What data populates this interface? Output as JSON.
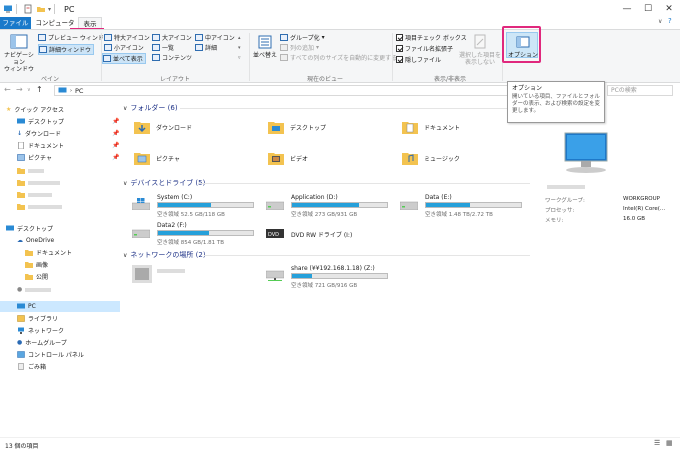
{
  "window": {
    "title": "PC"
  },
  "tabs": {
    "file": "ファイル",
    "computer": "コンピューター",
    "view": "表示"
  },
  "ribbon": {
    "pane_group": {
      "label": "ペイン",
      "nav_pane": "ナビゲーション\nウィンドウ",
      "preview": "プレビュー ウィンドウ",
      "details": "詳細ウィンドウ"
    },
    "layout_group": {
      "label": "レイアウト",
      "items": [
        "特大アイコン",
        "大アイコン",
        "中アイコン",
        "小アイコン",
        "一覧",
        "詳細",
        "並べて表示",
        "コンテンツ"
      ]
    },
    "current_view_group": {
      "label": "現在のビュー",
      "sort": "並べ替え",
      "group_by": "グループ化",
      "add_columns": "列の追加",
      "fit_columns": "すべての列のサイズを自動的に変更する"
    },
    "show_hide_group": {
      "label": "表示/非表示",
      "item_checkbox": "項目チェック ボックス",
      "extensions": "ファイル名拡張子",
      "hidden_files": "隠しファイル",
      "hide_selected": "選択した項目を\n表示しない"
    },
    "options": "オプション"
  },
  "tooltip": {
    "title": "オプション",
    "body": "開いている項目、ファイルとフォルダーの表示、および検索の設定を変更します。"
  },
  "address": {
    "path": "PC",
    "search_placeholder": "PCの検索"
  },
  "nav": {
    "quick_access": "クイック アクセス",
    "desktop": "デスクトップ",
    "downloads": "ダウンロード",
    "documents": "ドキュメント",
    "pictures": "ピクチャ",
    "onedrive_desktop": "デスクトップ",
    "onedrive": "OneDrive",
    "od_documents": "ドキュメント",
    "od_pictures": "画像",
    "od_public": "公開",
    "pc": "PC",
    "libraries": "ライブラリ",
    "network": "ネットワーク",
    "homegroup": "ホームグループ",
    "control_panel": "コントロール パネル",
    "recycle_bin": "ごみ箱"
  },
  "sections": {
    "folders": "フォルダー (6)",
    "devices": "デバイスとドライブ (5)",
    "network": "ネットワークの場所 (2)"
  },
  "folders": [
    "ダウンロード",
    "デスクトップ",
    "ドキュメント",
    "ピクチャ",
    "ビデオ",
    "ミュージック"
  ],
  "drives": [
    {
      "name": "System (C:)",
      "free": "空き領域 52.5 GB/118 GB",
      "used_fraction": 0.56
    },
    {
      "name": "Application (D:)",
      "free": "空き領域 273 GB/931 GB",
      "used_fraction": 0.71
    },
    {
      "name": "Data (E:)",
      "free": "空き領域 1.48 TB/2.72 TB",
      "used_fraction": 0.46
    },
    {
      "name": "Data2 (F:)",
      "free": "空き領域 854 GB/1.81 TB",
      "used_fraction": 0.54
    },
    {
      "name": "DVD RW ドライブ (I:)"
    }
  ],
  "network_locs": [
    {
      "name": "share (¥¥192.168.1.18) (Z:)",
      "free": "空き領域 721 GB/916 GB",
      "used_fraction": 0.21
    }
  ],
  "details_pane": {
    "workgroup_label": "ワークグループ:",
    "workgroup_value": "WORKGROUP",
    "processor_label": "プロセッサ:",
    "processor_value": "Intel(R) Core(...",
    "memory_label": "メモリ:",
    "memory_value": "16.0 GB"
  },
  "status": {
    "count": "13 個の項目"
  },
  "colors": {
    "accent": "#1979ca",
    "highlight": "#e0287d",
    "drive_fill": "#26a0da",
    "selection": "#cce8ff"
  }
}
